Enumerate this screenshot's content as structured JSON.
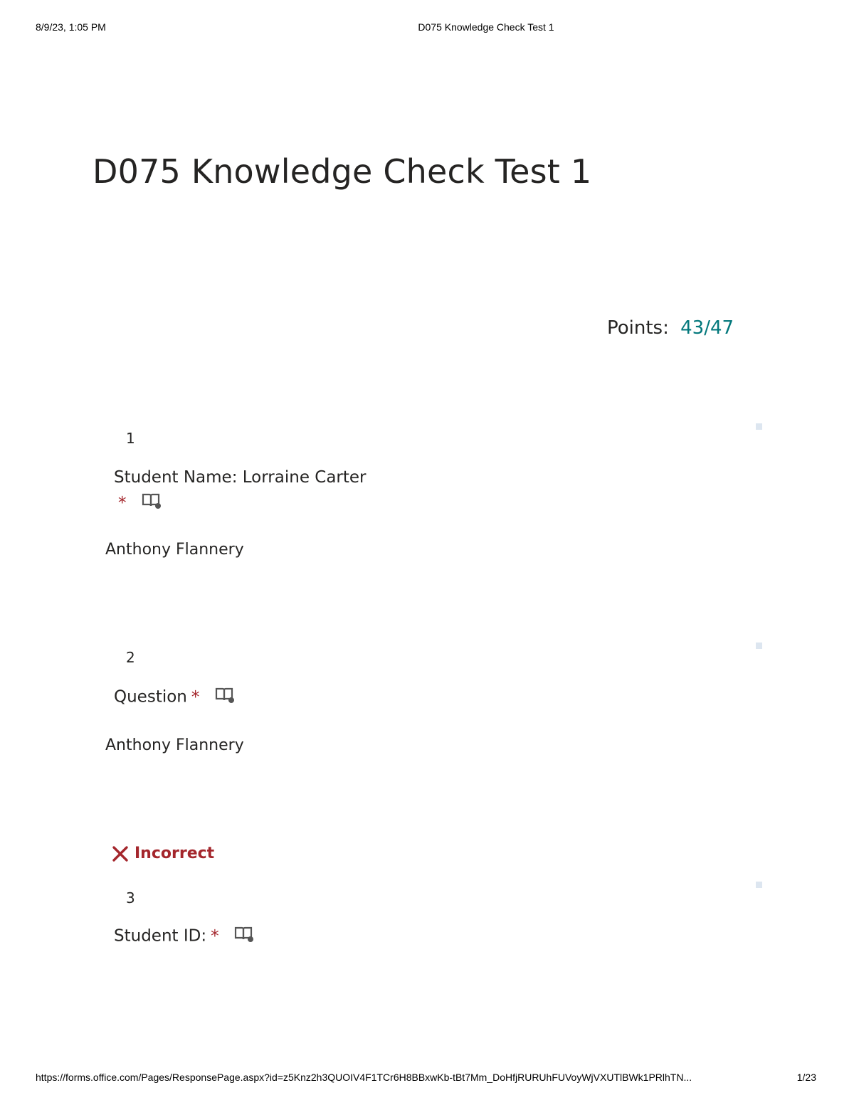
{
  "print": {
    "date": "8/9/23, 1:05 PM",
    "doc_title": "D075 Knowledge Check Test 1",
    "url": "https://forms.office.com/Pages/ResponsePage.aspx?id=z5Knz2h3QUOIV4F1TCr6H8BBxwKb-tBt7Mm_DoHfjRURUhFUVoyWjVXUTlBWk1PRlhTN...",
    "page": "1/23"
  },
  "form": {
    "title": "D075 Knowledge Check Test 1",
    "points_label": "Points:",
    "points_value": "43/47"
  },
  "questions": [
    {
      "number": "1",
      "title": "Student Name: Lorraine Carter",
      "required": "*",
      "answer": "Anthony Flannery"
    },
    {
      "number": "2",
      "title": "Question",
      "required": "*",
      "answer": "Anthony Flannery"
    },
    {
      "number": "3",
      "title": "Student ID:",
      "required": "*",
      "result": "Incorrect"
    }
  ],
  "icons": {
    "immersive_reader": "immersive-reader-icon",
    "incorrect": "x-mark-icon"
  },
  "colors": {
    "points_accent": "#03787c",
    "required_red": "#a4262c",
    "incorrect_red": "#a4262c"
  }
}
